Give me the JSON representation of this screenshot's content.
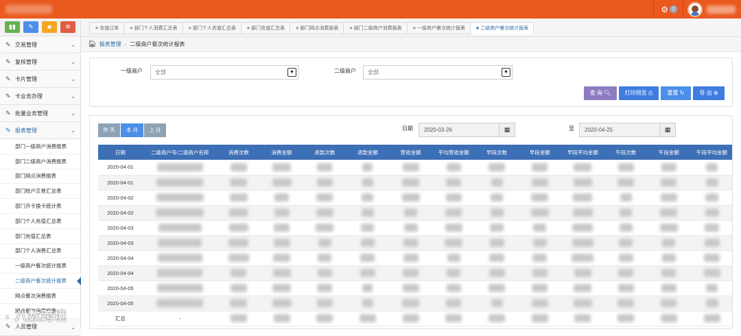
{
  "colors": {
    "brand": "#ea5a1f",
    "primary": "#2e6da4",
    "table_header": "#3d6fb6",
    "query": "#8e7cc3",
    "print": "#3f7de0",
    "reset": "#4b8fe8",
    "export": "#3f7de0",
    "period_inactive": "#8ea2b6",
    "period_active": "#4b8fe8"
  },
  "header": {
    "notification_count": "2",
    "icons": [
      "gear-icon",
      "user-avatar"
    ]
  },
  "shortcuts": [
    {
      "name": "chart-icon",
      "glyph": "▮▮",
      "color": "#67b04f"
    },
    {
      "name": "pencil-icon",
      "glyph": "✎",
      "color": "#4b8fe8"
    },
    {
      "name": "users-icon",
      "glyph": "☻",
      "color": "#f5a623"
    },
    {
      "name": "cogs-icon",
      "glyph": "✲",
      "color": "#e25b44"
    }
  ],
  "sidebar": {
    "menus": [
      {
        "label": "交易管理",
        "icon": "edit-icon"
      },
      {
        "label": "复核管理",
        "icon": "edit-icon"
      },
      {
        "label": "卡片管理",
        "icon": "edit-icon"
      },
      {
        "label": "卡业务办理",
        "icon": "edit-icon"
      },
      {
        "label": "批量业务管理",
        "icon": "edit-icon"
      },
      {
        "label": "报表管理",
        "icon": "edit-icon",
        "active": true
      }
    ],
    "submenu": [
      "部门一级商户消费报表",
      "部门二级商户消费报表",
      "部门网点消费报表",
      "部门账户交易汇总表",
      "部门开卡换卡统计表",
      "部门个人充值汇总表",
      "部门充值汇总表",
      "部门个人消费汇总表",
      "一级商户餐次统计报表",
      "二级商户餐次统计报表",
      "网点餐次消费报表",
      "网点餐次消费报表"
    ],
    "current_sub_index": 9,
    "last_menu": {
      "label": "人员管理",
      "icon": "edit-icon"
    }
  },
  "tabs": [
    "充值订单",
    "部门个人消费汇总表",
    "部门个人充值汇总表",
    "部门充值汇总表",
    "部门网点消费报表",
    "部门二级商户消费报表",
    "一级商户餐次统计报表",
    "二级商户餐次统计报表"
  ],
  "active_tab": 7,
  "breadcrumb": {
    "parent": "报表管理",
    "current": "二级商户餐次统计报表"
  },
  "filters": {
    "first_merchant_label": "一级商户",
    "first_merchant_value": "全部",
    "second_merchant_label": "二级商户",
    "second_merchant_value": "全部"
  },
  "buttons": {
    "query": "查 询",
    "print": "打印预览",
    "reset": "重置",
    "export": "导 出"
  },
  "period": {
    "yesterday": "昨 天",
    "this_month": "本 月",
    "last_month": "上 月",
    "active": "this_month"
  },
  "date_range": {
    "label": "日期",
    "start": "2020-03-26",
    "to_label": "至",
    "end": "2020-04-25"
  },
  "table": {
    "columns": [
      "日期",
      "二级商户号/二级商户名称",
      "消费次数",
      "消费金额",
      "退款次数",
      "退款金额",
      "营收金额",
      "平均营收金额",
      "早段次数",
      "早段金额",
      "早段平均金额",
      "午段次数",
      "午段金额",
      "午段平均金额"
    ],
    "rows": [
      {
        "date": "2020-04-01"
      },
      {
        "date": "2020-04-01"
      },
      {
        "date": "2020-04-02"
      },
      {
        "date": "2020-04-02"
      },
      {
        "date": "2020-04-03"
      },
      {
        "date": "2020-04-03"
      },
      {
        "date": "2020-04-04"
      },
      {
        "date": "2020-04-04"
      },
      {
        "date": "2020-04-05"
      },
      {
        "date": "2020-04-05"
      }
    ],
    "total_label": "汇总",
    "total_merchant": "-"
  },
  "watermark": "八数跨境"
}
